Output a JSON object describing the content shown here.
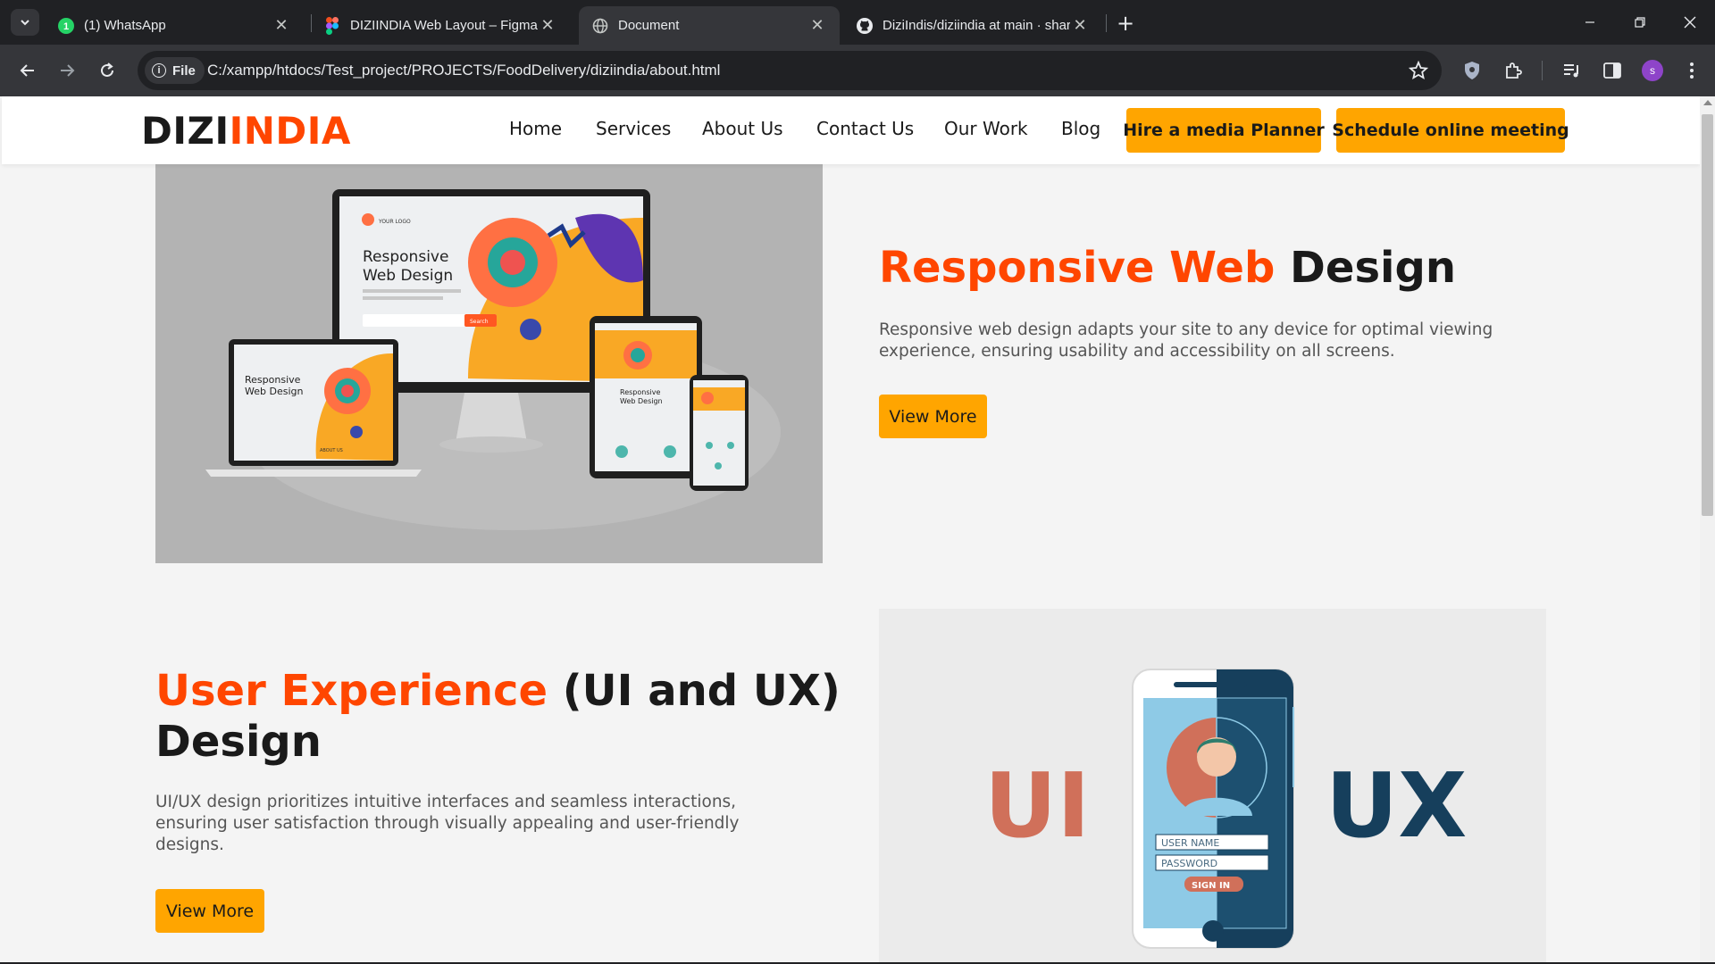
{
  "browser": {
    "tabs": [
      {
        "label": "(1) WhatsApp",
        "icon": "whatsapp-icon",
        "badge": "1"
      },
      {
        "label": "DIZIINDIA Web Layout – Figma",
        "icon": "figma-icon"
      },
      {
        "label": "Document",
        "icon": "globe-icon",
        "active": true
      },
      {
        "label": "DiziIndis/diziindia at main · shar",
        "icon": "github-icon"
      }
    ],
    "address": {
      "chip_label": "File",
      "url": "C:/xampp/htdocs/Test_project/PROJECTS/FoodDelivery/diziindia/about.html"
    },
    "profile_initial": "s"
  },
  "site": {
    "logo": {
      "part1": "DIZI",
      "part2": "INDIA"
    },
    "nav": [
      "Home",
      "Services",
      "About Us",
      "Contact Us",
      "Our Work",
      "Blog"
    ],
    "cta_hire": "Hire a media Planner",
    "cta_schedule": "Schedule online meeting",
    "colors": {
      "accent": "#ff4600",
      "button": "#ffa500",
      "dark": "#1a1a1a"
    }
  },
  "sections": [
    {
      "heading_accent": "Responsive Web",
      "heading_rest": " Design",
      "description": "Responsive web design adapts your site to any device for optimal viewing experience, ensuring usability and accessibility on all screens.",
      "button": "View More",
      "image": {
        "monitor_title_line1": "Responsive",
        "monitor_title_line2": "Web Design",
        "logo_text": "YOUR LOGO",
        "search_label": "Search",
        "about_label": "ABOUT US"
      }
    },
    {
      "heading_accent": "User Experience",
      "heading_rest": " (UI and UX)",
      "heading_line2": "Design",
      "description": "UI/UX design prioritizes intuitive interfaces and seamless interactions, ensuring user satisfaction through visually appealing and user-friendly designs.",
      "button": "View More",
      "image": {
        "left_text": "UI",
        "right_text": "UX",
        "field1": "USER NAME",
        "field2": "PASSWORD",
        "sign_btn": "SIGN IN"
      }
    }
  ]
}
